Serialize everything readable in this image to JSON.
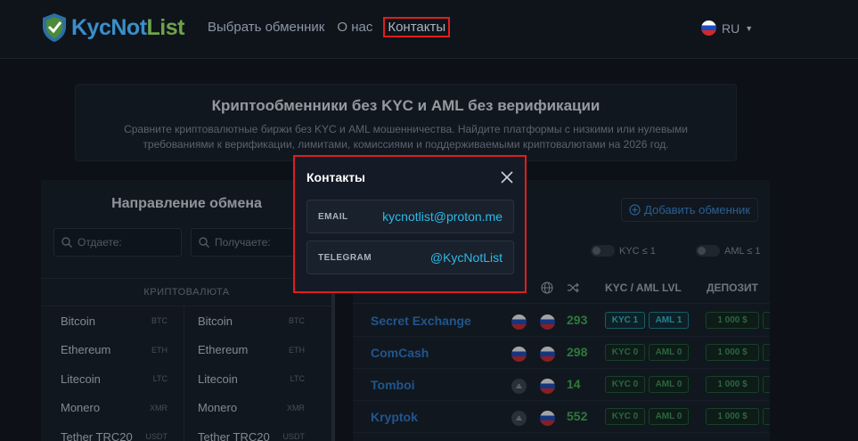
{
  "header": {
    "logo_text": "KycNotList",
    "nav": [
      "Выбрать обменник",
      "О нас",
      "Контакты"
    ],
    "lang": "RU"
  },
  "hero": {
    "title": "Криптообменники без KYC и AML без верификации",
    "subtitle": "Сравните криптовалютные биржи без KYC и AML мошенничества. Найдите платформы с низкими или нулевыми требованиями к верификации, лимитами, комиссиями и поддерживаемыми криптовалютами на 2026 год."
  },
  "left_panel": {
    "title": "Направление обмена",
    "give_placeholder": "Отдаете:",
    "get_placeholder": "Получаете:",
    "section_header": "КРИПТОВАЛЮТА",
    "coins": [
      {
        "name": "Bitcoin",
        "ticker": "BTC"
      },
      {
        "name": "Ethereum",
        "ticker": "ETH"
      },
      {
        "name": "Litecoin",
        "ticker": "LTC"
      },
      {
        "name": "Monero",
        "ticker": "XMR"
      },
      {
        "name": "Tether TRC20",
        "ticker": "USDT"
      }
    ]
  },
  "right_panel": {
    "add_button": "Добавить обменник",
    "kyc_toggle": "KYC ≤ 1",
    "aml_toggle": "AML ≤ 1",
    "columns": [
      "KYC / AML LVL",
      "ДЕПОЗИТ"
    ],
    "rows": [
      {
        "name": "Secret Exchange",
        "count": "293",
        "kyc": "KYC 1",
        "aml": "AML 1",
        "deposit": "1 000 $",
        "cut": "1",
        "active": true,
        "flag_a": "ru"
      },
      {
        "name": "ComCash",
        "count": "298",
        "kyc": "KYC 0",
        "aml": "AML 0",
        "deposit": "1 000 $",
        "cut": "2",
        "active": false,
        "flag_a": "ru"
      },
      {
        "name": "Tomboi",
        "count": "14",
        "kyc": "KYC 0",
        "aml": "AML 0",
        "deposit": "1 000 $",
        "cut": "1",
        "active": false,
        "flag_a": "globe"
      },
      {
        "name": "Kryptok",
        "count": "552",
        "kyc": "KYC 0",
        "aml": "AML 0",
        "deposit": "1 000 $",
        "cut": "1",
        "active": false,
        "flag_a": "globe"
      }
    ]
  },
  "modal": {
    "title": "Контакты",
    "email_label": "EMAIL",
    "email_value": "kycnotlist@proton.me",
    "telegram_label": "TELEGRAM",
    "telegram_value": "@KycNotList"
  }
}
